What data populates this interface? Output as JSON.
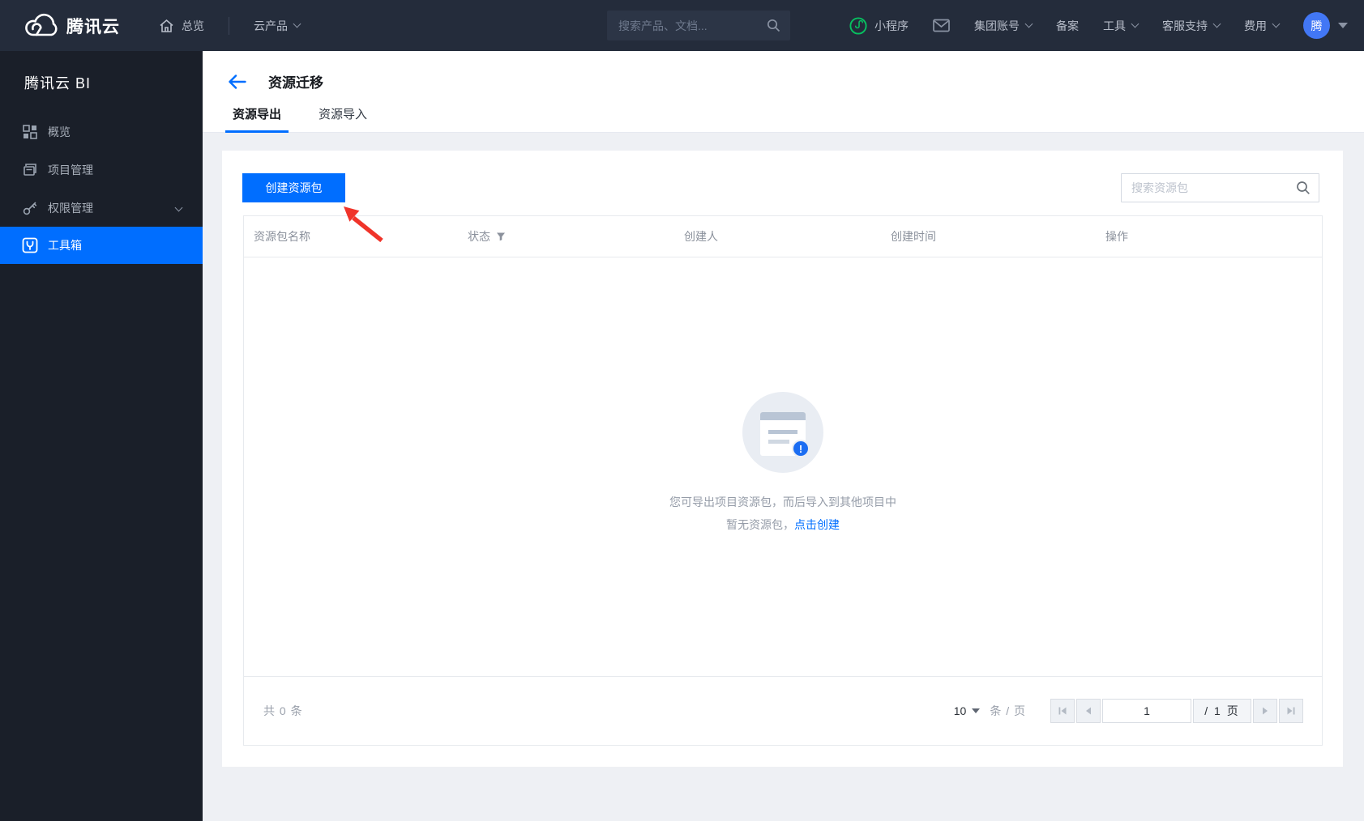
{
  "topnav": {
    "brand": "腾讯云",
    "overview": "总览",
    "cloud_products": "云产品",
    "search_placeholder": "搜索产品、文档...",
    "mini_program": "小程序",
    "group_account": "集团账号",
    "beian": "备案",
    "tools": "工具",
    "support": "客服支持",
    "billing": "费用",
    "avatar_text": "腾"
  },
  "sidebar": {
    "title": "腾讯云 BI",
    "items": [
      {
        "label": "概览",
        "icon": "overview-grid-icon",
        "active": false
      },
      {
        "label": "项目管理",
        "icon": "project-icon",
        "active": false
      },
      {
        "label": "权限管理",
        "icon": "key-icon",
        "active": false,
        "has_submenu": true
      },
      {
        "label": "工具箱",
        "icon": "toolbox-icon",
        "active": true
      }
    ]
  },
  "page": {
    "title": "资源迁移",
    "tabs": [
      {
        "label": "资源导出",
        "active": true
      },
      {
        "label": "资源导入",
        "active": false
      }
    ]
  },
  "content": {
    "create_button": "创建资源包",
    "search_placeholder": "搜索资源包",
    "table": {
      "columns": [
        "资源包名称",
        "状态",
        "创建人",
        "创建时间",
        "操作"
      ],
      "rows": []
    },
    "empty": {
      "line1": "您可导出项目资源包，而后导入到其他项目中",
      "line2_prefix": "暂无资源包，",
      "line2_link": "点击创建"
    },
    "footer": {
      "total": "共 0 条",
      "page_size": "10",
      "unit": "条 / 页",
      "page_input": "1",
      "page_total": "/ 1 页"
    }
  },
  "colors": {
    "accent_blue": "#006eff",
    "navbar_bg": "#242c3b",
    "sidebar_bg": "#1a1f29",
    "content_bg": "#eef0f4",
    "annotation_red": "#f0342a",
    "mini_program_green": "#07c160",
    "avatar_blue": "#4277f5"
  }
}
